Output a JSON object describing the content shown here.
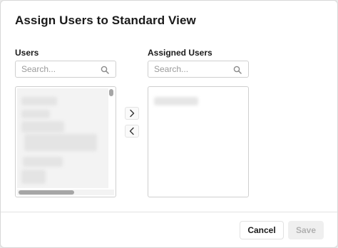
{
  "dialog": {
    "title": "Assign Users to Standard View"
  },
  "users_panel": {
    "label": "Users",
    "search_placeholder": "Search..."
  },
  "assigned_panel": {
    "label": "Assigned Users",
    "search_placeholder": "Search..."
  },
  "controls": {
    "add_icon": "chevron-right-icon",
    "remove_icon": "chevron-left-icon"
  },
  "footer": {
    "cancel_label": "Cancel",
    "save_label": "Save",
    "save_enabled": false
  }
}
